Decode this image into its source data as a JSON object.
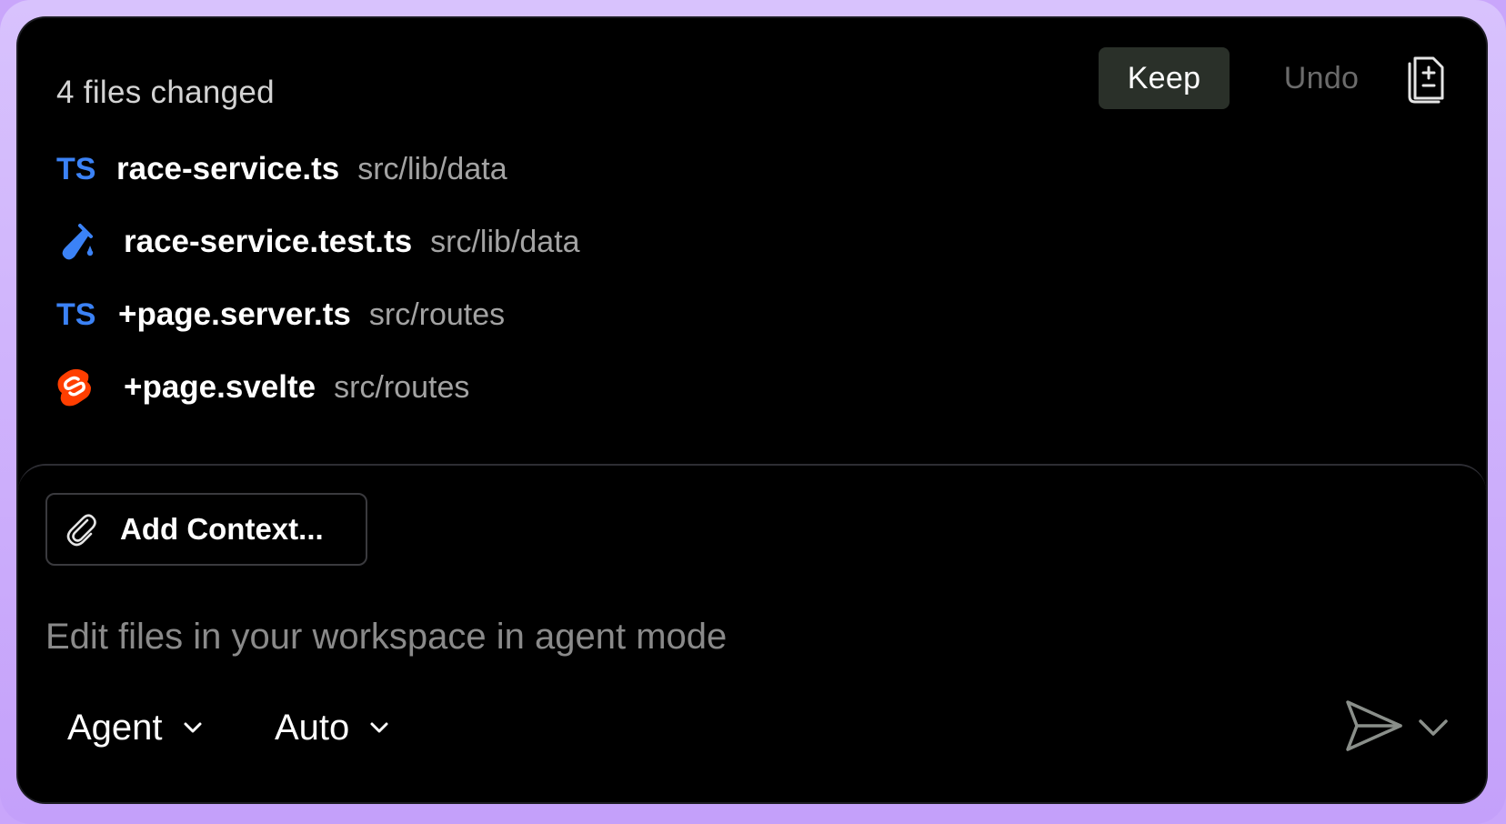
{
  "header": {
    "title": "4 files changed",
    "keep_label": "Keep",
    "undo_label": "Undo",
    "diff_icon": "file-diff-icon"
  },
  "files": [
    {
      "icon": "typescript-icon",
      "icon_text": "TS",
      "name": "race-service.ts",
      "path": "src/lib/data"
    },
    {
      "icon": "test-tube-icon",
      "icon_text": "",
      "name": "race-service.test.ts",
      "path": "src/lib/data"
    },
    {
      "icon": "typescript-icon",
      "icon_text": "TS",
      "name": "+page.server.ts",
      "path": "src/routes"
    },
    {
      "icon": "svelte-icon",
      "icon_text": "",
      "name": "+page.svelte",
      "path": "src/routes"
    }
  ],
  "composer": {
    "add_context_label": "Add Context...",
    "placeholder": "Edit files in your workspace in agent mode",
    "mode_label": "Agent",
    "model_label": "Auto"
  },
  "colors": {
    "frame": "#c9a6fb",
    "panel": "#000000",
    "ts_blue": "#3b82f6",
    "svelte_red": "#ff3e00",
    "keep_bg": "#2a3029"
  }
}
